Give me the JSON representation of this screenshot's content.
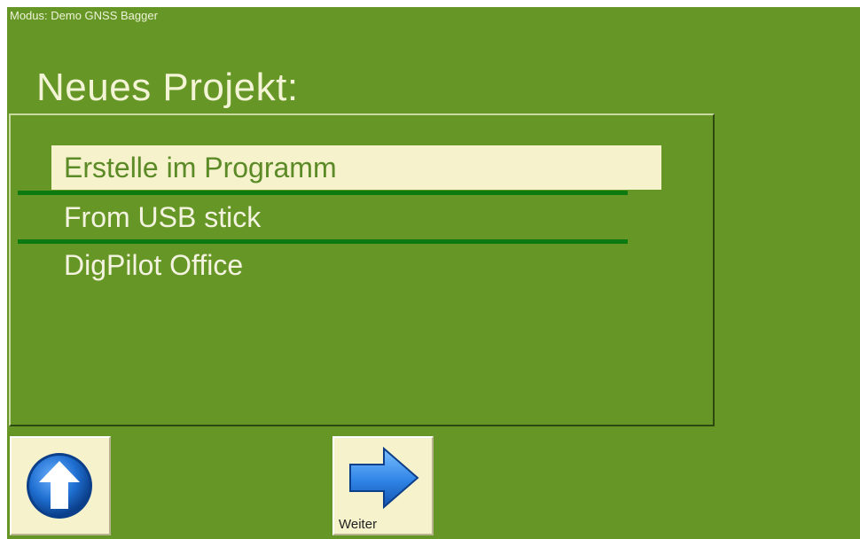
{
  "header": {
    "mode_text": "Modus: Demo GNSS Bagger"
  },
  "page": {
    "title": "Neues Projekt:"
  },
  "project_source_list": {
    "items": [
      {
        "label": "Erstelle im Programm",
        "selected": true
      },
      {
        "label": "From USB stick",
        "selected": false
      },
      {
        "label": "DigPilot Office",
        "selected": false
      }
    ]
  },
  "toolbar": {
    "up_button": {
      "icon": "arrow-up-circle-icon"
    },
    "next_button": {
      "label": "Weiter",
      "icon": "arrow-right-icon"
    }
  },
  "colors": {
    "background": "#669726",
    "selection": "#f5f2cc",
    "separator": "#0c7a10",
    "button_face": "#f5f2cc",
    "icon_blue": "#1f6fd1"
  }
}
